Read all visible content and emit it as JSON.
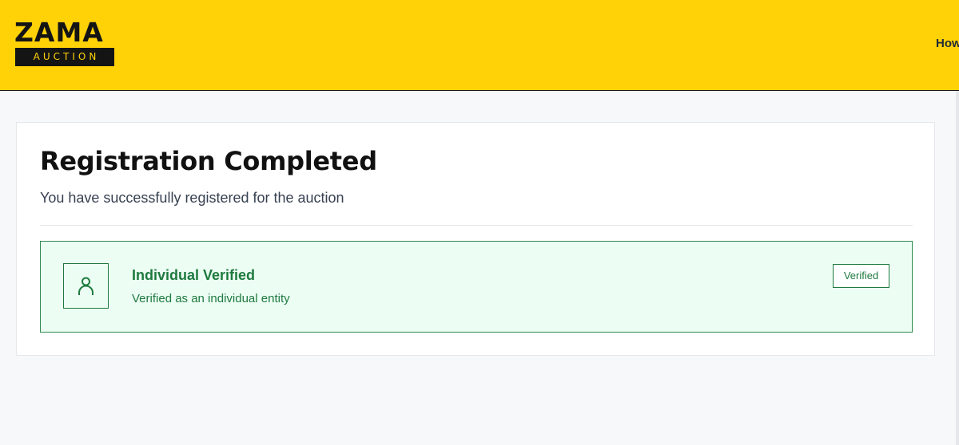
{
  "header": {
    "logo_word": "ZAMA",
    "logo_sub": "AUCTION",
    "nav_link": "How"
  },
  "card": {
    "title": "Registration Completed",
    "subtitle": "You have successfully registered for the auction",
    "verification": {
      "icon": "user-icon",
      "title": "Individual Verified",
      "description": "Verified as an individual entity",
      "badge": "Verified"
    }
  },
  "colors": {
    "brand_yellow": "#ffd208",
    "brand_dark": "#141414",
    "success_green": "#1e7a3f",
    "success_bg": "#ecfdf3",
    "page_bg": "#f7f8fa"
  }
}
